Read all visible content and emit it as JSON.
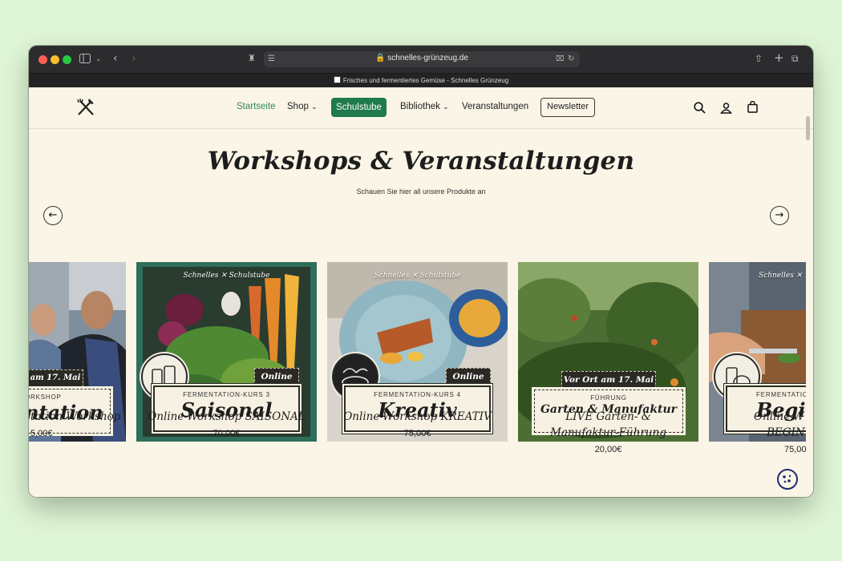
{
  "browser": {
    "url": "schnelles-grünzeug.de",
    "tab_title": "Frisches und fermentiertes Gemüse - Schnelles Grünzeug",
    "colors": {
      "close": "#ff5f57",
      "minimize": "#febc2e",
      "zoom": "#28c840"
    }
  },
  "nav": {
    "items": [
      {
        "label": "Startseite"
      },
      {
        "label": "Shop"
      },
      {
        "label": "Schulstube"
      },
      {
        "label": "Bibliothek"
      },
      {
        "label": "Veranstaltungen"
      },
      {
        "label": "Newsletter"
      }
    ]
  },
  "section": {
    "title": "Workshops & Veranstaltungen",
    "subtitle": "Schauen Sie hier all unsere Produkte an"
  },
  "cards": [
    {
      "badge": "am 17. Mai",
      "kicker": "ORKSHOP",
      "name": "ntation",
      "title": "tation Workshop",
      "price": "5,00€"
    },
    {
      "watermark_left": "Schnelles",
      "watermark_right": "Schulstube",
      "badge": "Online",
      "kicker": "FERMENTATION-KURS 3",
      "name": "Saisonal",
      "title": "Online-Workshop SAISONAL",
      "price": "70,00€"
    },
    {
      "watermark_left": "Schnelles",
      "watermark_right": "Schulstube",
      "badge": "Online",
      "kicker": "FERMENTATION-KURS 4",
      "name": "Kreativ",
      "title": "Online-Workshop KREATIV",
      "price": "75,00€"
    },
    {
      "badge": "Vor Ort am 17. Mai",
      "kicker": "FÜHRUNG",
      "name": "Garten & Manufaktur",
      "title_line1": "LIVE Garten- &",
      "title_line2": "Manufaktur-Führung",
      "price": "20,00€"
    },
    {
      "watermark_left": "Schnelles",
      "kicker": "FERMENTATIO",
      "name": "Begin",
      "title_line1": "Online-W",
      "title_line2": "BEGIN",
      "price": "75,00"
    }
  ]
}
